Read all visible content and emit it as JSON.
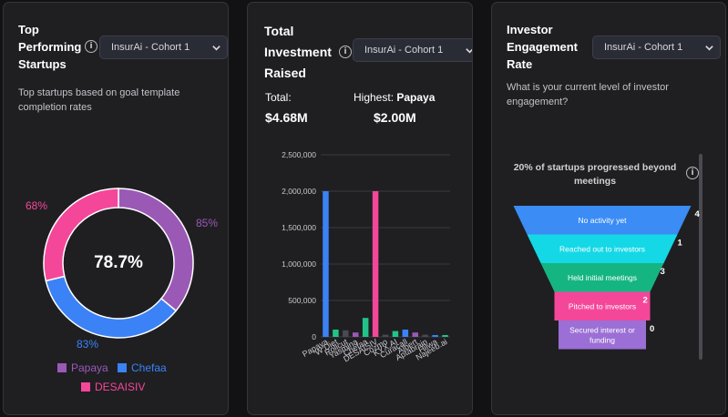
{
  "card1": {
    "title_lines": [
      "Top",
      "Performing",
      "Startups"
    ],
    "cohort_select": "InsurAi - Cohort 1",
    "subtitle": "Top startups based on goal template completion rates",
    "center_value": "78.7%",
    "label_papaya": "85%",
    "label_chefaa": "83%",
    "label_desaisiv": "68%",
    "legend": [
      "Papaya",
      "Chefaa",
      "DESAISIV"
    ],
    "colors": {
      "papaya": "#9b59b6",
      "chefaa": "#3b82f6",
      "desaisiv": "#f4479a"
    },
    "chart_data": {
      "type": "pie",
      "labels": [
        "Papaya",
        "Chefaa",
        "DESAISIV"
      ],
      "values": [
        85,
        83,
        68
      ],
      "center_label": "78.7%"
    }
  },
  "card2": {
    "title_lines": [
      "Total",
      "Investment",
      "Raised"
    ],
    "cohort_select": "InsurAi - Cohort 1",
    "total_label": "Total:",
    "total_value": "$4.68M",
    "highest_label": "Highest:",
    "highest_name": "Papaya",
    "highest_value": "$2.00M",
    "chart_data": {
      "type": "bar",
      "categories": [
        "Papaya",
        "W Diet",
        "Rollcut",
        "Yasmina",
        "Chefaa",
        "DESAISIV",
        "Cozmo",
        "KYX.AI",
        "Curacall",
        "Albert",
        "Aptabrain",
        "Hilwa",
        "Najeeb.ai"
      ],
      "values": [
        2000000,
        100000,
        90000,
        60000,
        260000,
        2000000,
        30000,
        80000,
        100000,
        60000,
        30000,
        25000,
        25000
      ],
      "colors": [
        "#3b82f6",
        "#22c389",
        "#4a4a52",
        "#9b59b6",
        "#22c389",
        "#f4479a",
        "#4a4a52",
        "#22c389",
        "#3b82f6",
        "#9b59b6",
        "#4a4a52",
        "#3b82f6",
        "#22c389"
      ],
      "yticks": [
        "0",
        "500,000",
        "1,000,000",
        "1,500,000",
        "2,000,000",
        "2,500,000"
      ],
      "ylim": [
        0,
        2500000
      ]
    }
  },
  "card3": {
    "title_lines": [
      "Investor",
      "Engagement",
      "Rate"
    ],
    "cohort_select": "InsurAi - Cohort 1",
    "subtitle": "What is your current level of investor engagement?",
    "funnel_note": "20% of startups progressed beyond meetings",
    "chart_data": {
      "type": "funnel",
      "stages": [
        "No activity yet",
        "Reached out to investors",
        "Held initial meetings",
        "Pitched to investors",
        "Secured interest or funding"
      ],
      "values": [
        4,
        1,
        3,
        2,
        0
      ],
      "colors": [
        "#3b8cf4",
        "#14d8e6",
        "#15b582",
        "#f4479a",
        "#9b6fd6"
      ]
    }
  }
}
